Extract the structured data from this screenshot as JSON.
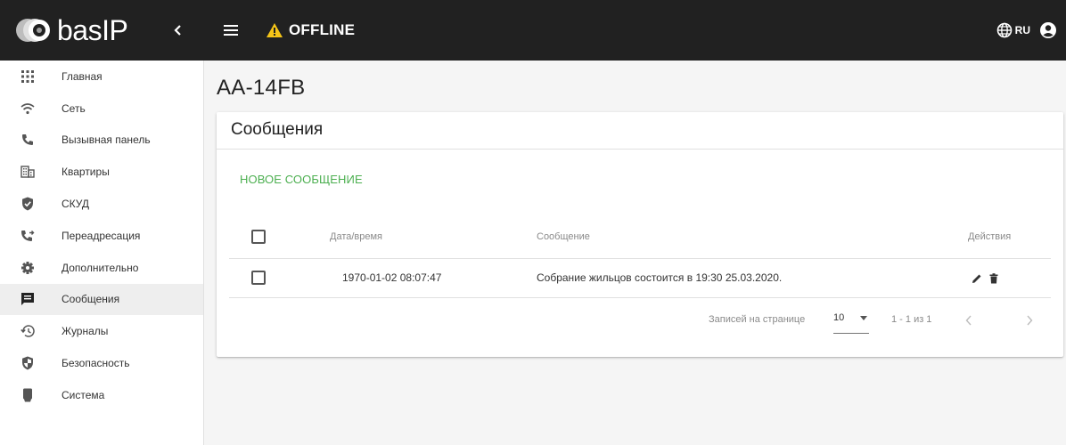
{
  "header": {
    "brand": "basIP",
    "status": "OFFLINE",
    "language": "RU",
    "icons": {
      "collapse": "chevron-left-icon",
      "menu": "hamburger-menu-icon",
      "warning": "warning-icon",
      "globe": "globe-icon",
      "account": "account-circle-icon"
    },
    "warning_color": "#f5c518"
  },
  "sidebar": {
    "items": [
      {
        "label": "Главная",
        "icon": "grid-icon"
      },
      {
        "label": "Сеть",
        "icon": "wifi-icon"
      },
      {
        "label": "Вызывная панель",
        "icon": "phone-icon"
      },
      {
        "label": "Квартиры",
        "icon": "building-icon"
      },
      {
        "label": "СКУД",
        "icon": "shield-check-icon"
      },
      {
        "label": "Переадресация",
        "icon": "phone-forward-icon"
      },
      {
        "label": "Дополнительно",
        "icon": "gear-icon"
      },
      {
        "label": "Сообщения",
        "icon": "message-icon"
      },
      {
        "label": "Журналы",
        "icon": "history-icon"
      },
      {
        "label": "Безопасность",
        "icon": "security-shield-icon"
      },
      {
        "label": "Система",
        "icon": "device-icon"
      }
    ],
    "active_index": 7
  },
  "main": {
    "title": "AA-14FB",
    "card": {
      "title": "Сообщения",
      "new_button": "НОВОЕ СООБЩЕНИЕ",
      "accent_color": "#4caf50",
      "columns": {
        "datetime": "Дата/время",
        "message": "Сообщение",
        "actions": "Действия"
      },
      "rows": [
        {
          "datetime": "1970-01-02 08:07:47",
          "message": "Собрание жильцов состоится в 19:30 25.03.2020."
        }
      ],
      "pagination": {
        "rows_per_page_label": "Записей на странице",
        "rows_per_page": "10",
        "range": "1 - 1 из 1"
      }
    }
  }
}
